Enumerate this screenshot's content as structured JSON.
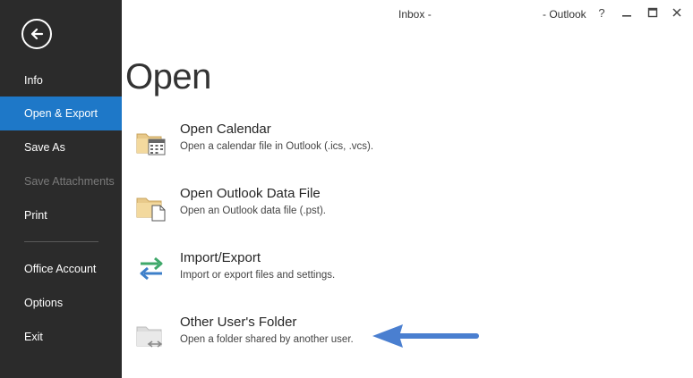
{
  "titlebar": {
    "inbox_label": "Inbox -",
    "app_label": "- Outlook",
    "help_icon": "?",
    "minimize_icon": "minimize-icon",
    "maximize_icon": "maximize-icon",
    "close_icon": "close-icon"
  },
  "sidebar": {
    "back_icon": "back-arrow-icon",
    "items": [
      {
        "label": "Info"
      },
      {
        "label": "Open & Export",
        "active": true
      },
      {
        "label": "Save As"
      },
      {
        "label": "Save Attachments",
        "disabled": true
      },
      {
        "label": "Print"
      },
      {
        "label": "Office Account"
      },
      {
        "label": "Options"
      },
      {
        "label": "Exit"
      }
    ]
  },
  "main": {
    "title": "Open",
    "options": [
      {
        "title": "Open Calendar",
        "description": "Open a calendar file in Outlook (.ics, .vcs).",
        "icon": "calendar-folder-icon"
      },
      {
        "title": "Open Outlook Data File",
        "description": "Open an Outlook data file (.pst).",
        "icon": "data-file-folder-icon"
      },
      {
        "title": "Import/Export",
        "description": "Import or export files and settings.",
        "icon": "import-export-icon"
      },
      {
        "title": "Other User's Folder",
        "description": "Open a folder shared by another user.",
        "icon": "shared-folder-icon"
      }
    ]
  },
  "colors": {
    "sidebar_bg": "#2b2b2b",
    "accent": "#1e78c8",
    "annotation_arrow": "#4a7fd0"
  }
}
